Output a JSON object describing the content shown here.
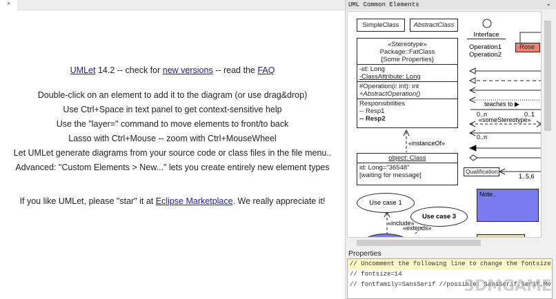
{
  "tab": {
    "close": "×"
  },
  "welcome": {
    "line1": {
      "umlet": "UMLet",
      "version_text": " 14.2 -- check for ",
      "new_versions": "new versions",
      "read_text": " -- read the ",
      "faq": "FAQ"
    },
    "tips": [
      "Double-click on an element to add it to the diagram (or use drag&drop)",
      "Use Ctrl+Space in text panel to get context-sensitive help",
      "Use the \"layer=\" command to move elements to front/to back",
      "Lasso with Ctrl+Mouse -- zoom with Ctrl+MouseWheel",
      "Let UMLet generate diagrams from your source code or class files in the file menu..",
      "Advanced: \"Custom Elements > New...\" lets you create entirely new element types"
    ],
    "star": {
      "pre": "If you like UMLet, please \"star\" it at ",
      "link": "Eclipse Marketplace",
      "post": ". We really appreciate it!"
    }
  },
  "palette": {
    "title": "UML Common Elements",
    "simple_class": "SimpleClass",
    "abstract_class": "AbstractClass",
    "fat_class": {
      "stereotype": "«Stereotype»",
      "name": "Package::FatClass",
      "props": "{Some Properties}",
      "attr1": "-id: Long",
      "attr2": "-ClassAttribute: Long",
      "op1": "#Operation(i: int): int",
      "op2": "+AbstractOperation()",
      "resp": "Responsibilities",
      "resp1": "-- Resp1",
      "resp2": "-- Resp2"
    },
    "instance_of": "«instanceOf»",
    "object": {
      "name": "object: Class",
      "l1": "id: Long=\"36548\"",
      "l2": "[waiting for message]"
    },
    "interface": {
      "name": "Interface",
      "op1": "Operation1",
      "op2": "Operation2"
    },
    "rose": "Rose",
    "teaches": "teaches to ▶",
    "mult1": "0..n",
    "mult2": "0..1",
    "some_stereo": "«someStereotype»",
    "mult3": "0..n",
    "qualification": "Qualification",
    "qual_mult": "1..5,6",
    "usecase1": "Use case 1",
    "usecase3": "Use case 3",
    "include": "«include»",
    "extends": "«extends»",
    "note": "Note..",
    "note_color": "#7b7bf0",
    "rose_color": "#f08070"
  },
  "properties": {
    "label": "Properties",
    "lines": [
      "// Uncomment the following line to change the fontsize",
      "// fontsize=14",
      "// fontfamily=SansSerif //possible: SansSerif,Serif,Mo"
    ],
    "highlight": "#fff9c4"
  },
  "watermark": "3DMGAME"
}
